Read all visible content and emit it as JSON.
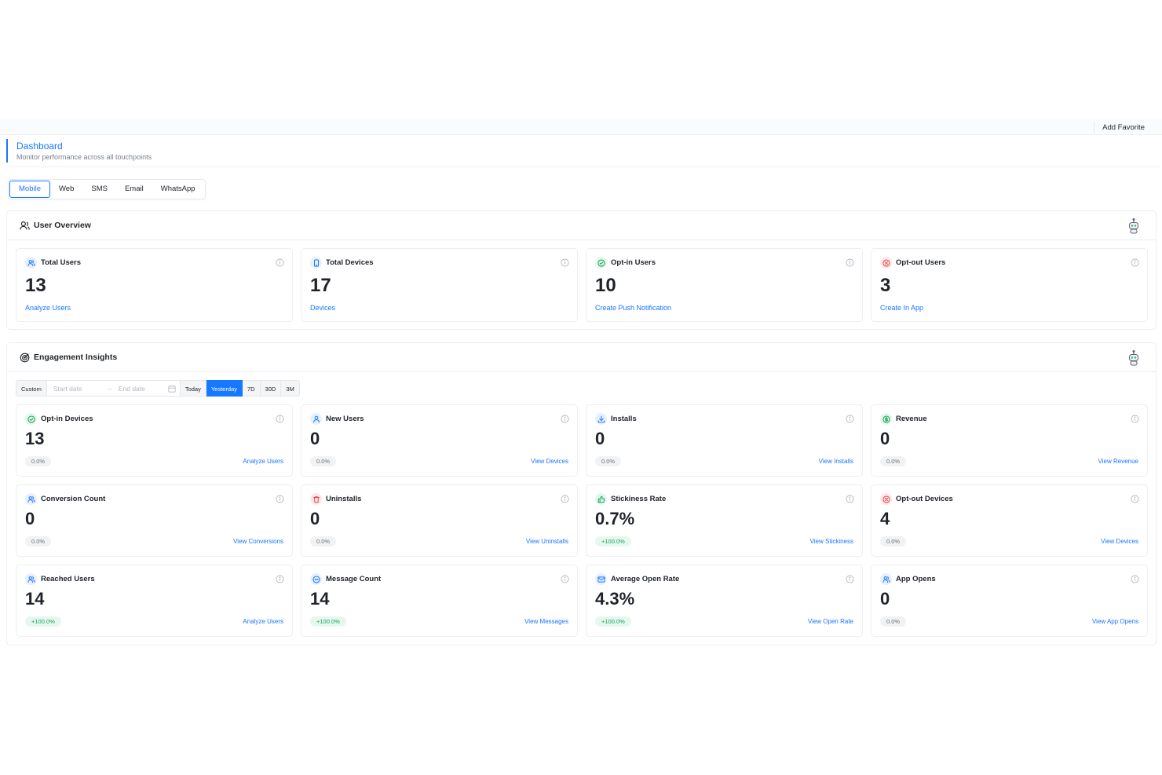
{
  "header": {
    "add_favorite": "Add Favorite"
  },
  "page": {
    "title": "Dashboard",
    "subtitle": "Monitor performance across all touchpoints"
  },
  "tabs": [
    {
      "label": "Mobile",
      "active": true
    },
    {
      "label": "Web",
      "active": false
    },
    {
      "label": "SMS",
      "active": false
    },
    {
      "label": "Email",
      "active": false
    },
    {
      "label": "WhatsApp",
      "active": false
    }
  ],
  "user_overview": {
    "title": "User Overview",
    "cards": [
      {
        "title": "Total Users",
        "value": "13",
        "link": "Analyze Users",
        "icon": "users-icon",
        "tone": "blue"
      },
      {
        "title": "Total Devices",
        "value": "17",
        "link": "Devices",
        "icon": "mobile-icon",
        "tone": "blue"
      },
      {
        "title": "Opt-in Users",
        "value": "10",
        "link": "Create Push Notification",
        "icon": "check-circle-icon",
        "tone": "green"
      },
      {
        "title": "Opt-out Users",
        "value": "3",
        "link": "Create In App",
        "icon": "x-circle-icon",
        "tone": "red"
      }
    ]
  },
  "engagement": {
    "title": "Engagement Insights",
    "date_filter": {
      "custom_label": "Custom",
      "start_placeholder": "Start date",
      "end_placeholder": "End date",
      "arrow": "→",
      "presets": [
        {
          "label": "Today",
          "active": false
        },
        {
          "label": "Yesterday",
          "active": true
        },
        {
          "label": "7D",
          "active": false
        },
        {
          "label": "30D",
          "active": false
        },
        {
          "label": "3M",
          "active": false
        }
      ]
    },
    "cards": [
      {
        "title": "Opt-in Devices",
        "value": "13",
        "change": "0.0%",
        "link": "Analyze Users",
        "icon": "check-circle-icon",
        "tone": "green",
        "trend": "flat"
      },
      {
        "title": "New Users",
        "value": "0",
        "change": "0.0%",
        "link": "View Devices",
        "icon": "user-icon",
        "tone": "blue",
        "trend": "flat"
      },
      {
        "title": "Installs",
        "value": "0",
        "change": "0.0%",
        "link": "View Installs",
        "icon": "download-icon",
        "tone": "blue",
        "trend": "flat"
      },
      {
        "title": "Revenue",
        "value": "0",
        "change": "0.0%",
        "link": "View Revenue",
        "icon": "dollar-icon",
        "tone": "green",
        "trend": "flat"
      },
      {
        "title": "Conversion Count",
        "value": "0",
        "change": "0.0%",
        "link": "View Conversions",
        "icon": "users-icon",
        "tone": "blue",
        "trend": "flat"
      },
      {
        "title": "Uninstalls",
        "value": "0",
        "change": "0.0%",
        "link": "View Uninstalls",
        "icon": "trash-icon",
        "tone": "red",
        "trend": "flat"
      },
      {
        "title": "Stickiness Rate",
        "value": "0.7%",
        "change": "+100.0%",
        "link": "View Stickiness",
        "icon": "thumbs-up-icon",
        "tone": "green",
        "trend": "up"
      },
      {
        "title": "Opt-out Devices",
        "value": "4",
        "change": "0.0%",
        "link": "View Devices",
        "icon": "x-circle-icon",
        "tone": "red",
        "trend": "flat"
      },
      {
        "title": "Reached Users",
        "value": "14",
        "change": "+100.0%",
        "link": "Analyze Users",
        "icon": "users-icon",
        "tone": "blue",
        "trend": "up"
      },
      {
        "title": "Message Count",
        "value": "14",
        "change": "+100.0%",
        "link": "View Messages",
        "icon": "message-icon",
        "tone": "blue",
        "trend": "up"
      },
      {
        "title": "Average Open Rate",
        "value": "4.3%",
        "change": "+100.0%",
        "link": "View Open Rate",
        "icon": "mail-icon",
        "tone": "blue",
        "trend": "up"
      },
      {
        "title": "App Opens",
        "value": "0",
        "change": "0.0%",
        "link": "View App Opens",
        "icon": "users-icon",
        "tone": "blue",
        "trend": "flat"
      }
    ]
  },
  "colors": {
    "accent": "#1677ff",
    "positive": "#19a35a",
    "negative": "#e5484d"
  }
}
